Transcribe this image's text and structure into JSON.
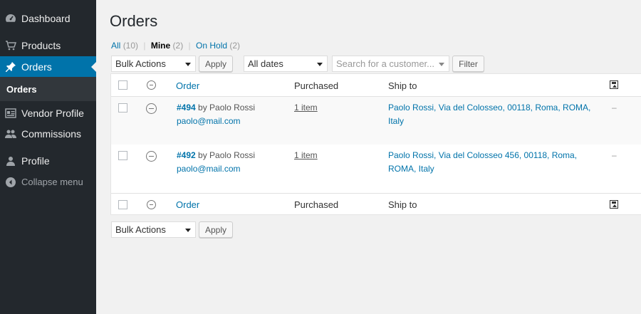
{
  "sidebar": {
    "items": [
      {
        "label": "Dashboard",
        "icon": "dashboard-icon"
      },
      {
        "label": "Products",
        "icon": "cart-icon"
      },
      {
        "label": "Orders",
        "icon": "pin-icon"
      },
      {
        "label": "Vendor Profile",
        "icon": "profile-card-icon"
      },
      {
        "label": "Commissions",
        "icon": "users-icon"
      },
      {
        "label": "Profile",
        "icon": "user-icon"
      }
    ],
    "submenu_label": "Orders",
    "collapse_label": "Collapse menu",
    "accent_color": "#0073aa"
  },
  "page": {
    "title": "Orders"
  },
  "filters": {
    "all_label": "All",
    "all_count": "(10)",
    "mine_label": "Mine",
    "mine_count": "(2)",
    "hold_label": "On Hold",
    "hold_count": "(2)"
  },
  "toolbar": {
    "bulk_actions": "Bulk Actions",
    "apply_label": "Apply",
    "dates": "All dates",
    "customer_placeholder": "Search for a customer...",
    "filter_label": "Filter"
  },
  "table": {
    "columns": [
      "Order",
      "Purchased",
      "Ship to"
    ],
    "rows": [
      {
        "order_number": "#494",
        "by_text": "by Paolo Rossi",
        "email": "paolo@mail.com",
        "purchased": "1 item",
        "ship_line1": "Paolo Rossi, Via del Colosseo, 00118, Roma, ROMA,",
        "ship_line2": "Italy",
        "extra": "–"
      },
      {
        "order_number": "#492",
        "by_text": "by Paolo Rossi",
        "email": "paolo@mail.com",
        "purchased": "1 item",
        "ship_line1": "Paolo Rossi, Via del Colosseo 456, 00118, Roma,",
        "ship_line2": "ROMA, Italy",
        "extra": "–"
      }
    ]
  },
  "bottom_toolbar": {
    "bulk_actions": "Bulk Actions",
    "apply_label": "Apply"
  }
}
